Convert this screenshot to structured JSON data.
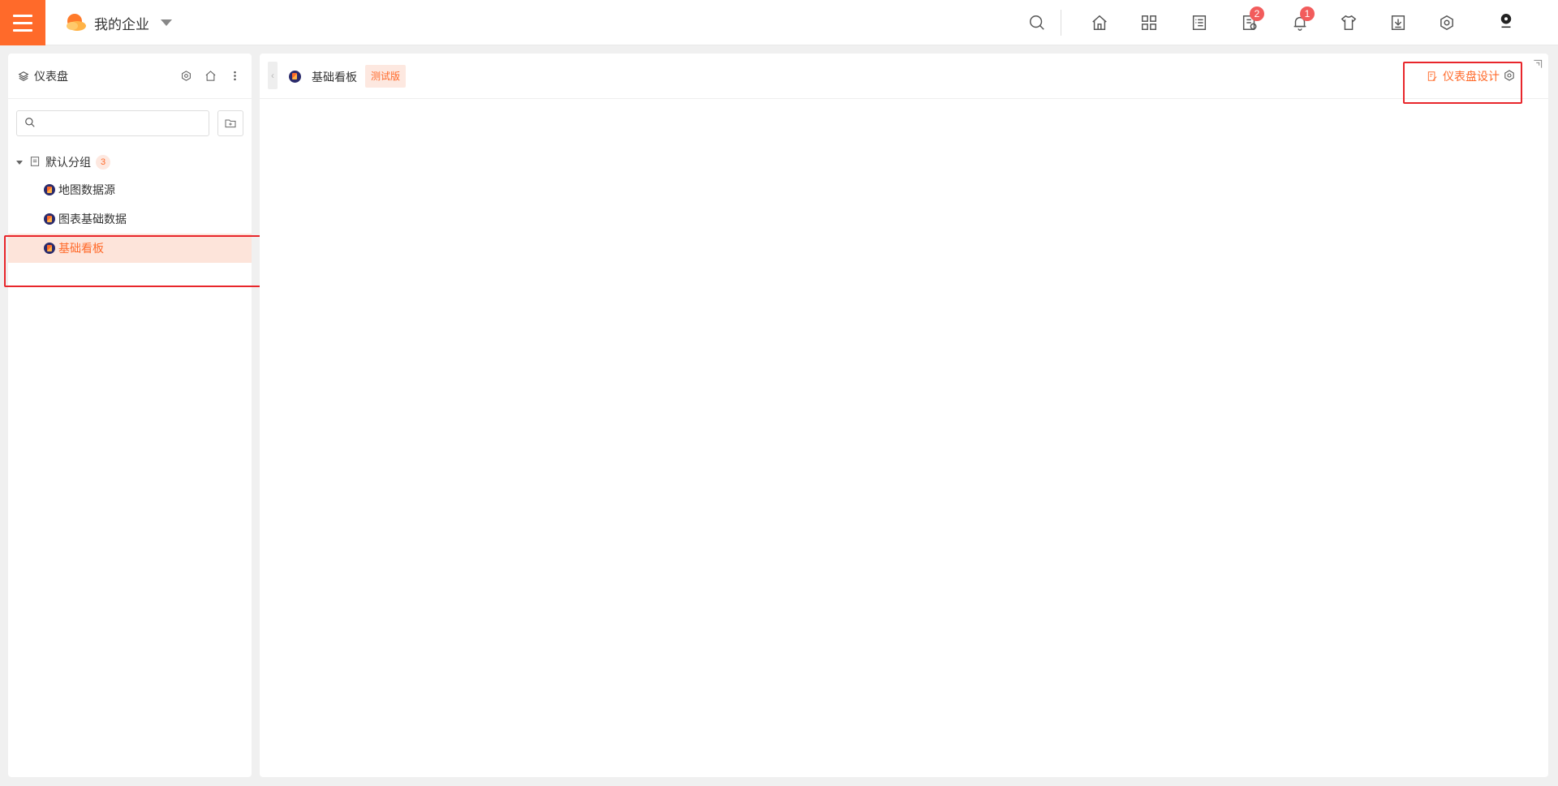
{
  "header": {
    "org_name": "我的企业",
    "icons": [
      "search-icon",
      "home-icon",
      "apps-icon",
      "list-icon",
      "task-icon",
      "bell-icon",
      "shirt-icon",
      "download-icon",
      "gear-icon",
      "avatar"
    ],
    "task_badge": "2",
    "bell_badge": "1"
  },
  "sidebar": {
    "title": "仪表盘",
    "search": {
      "placeholder": "",
      "value": ""
    },
    "group": {
      "label": "默认分组",
      "count": "3"
    },
    "items": [
      {
        "label": "地图数据源"
      },
      {
        "label": "图表基础数据"
      },
      {
        "label": "基础看板"
      }
    ]
  },
  "main": {
    "title": "基础看板",
    "tag": "测试版",
    "design_label": "仪表盘设计"
  },
  "colors": {
    "accent": "#ff6a2a",
    "highlight_box": "#e8262b",
    "active_row": "#fde4da"
  }
}
